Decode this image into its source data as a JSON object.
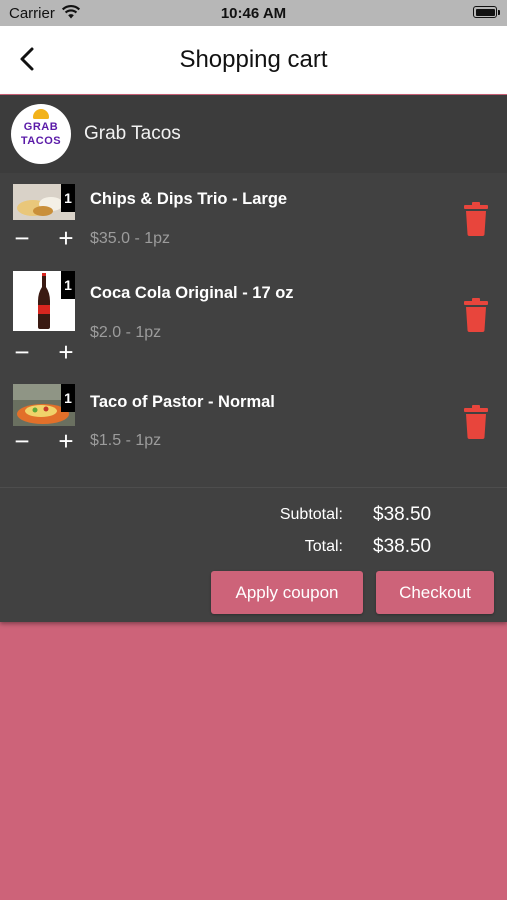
{
  "status_bar": {
    "carrier": "Carrier",
    "time": "10:46 AM"
  },
  "nav": {
    "title": "Shopping cart"
  },
  "store": {
    "name": "Grab Tacos",
    "logo_line1": "GRAB",
    "logo_line2": "TACOS"
  },
  "items": [
    {
      "name": "Chips & Dips Trio - Large",
      "price": "$35.0 - 1pz",
      "qty": "1"
    },
    {
      "name": "Coca Cola Original - 17 oz",
      "price": "$2.0 - 1pz",
      "qty": "1"
    },
    {
      "name": "Taco of Pastor - Normal",
      "price": "$1.5 - 1pz",
      "qty": "1"
    }
  ],
  "summary": {
    "subtotal_label": "Subtotal:",
    "subtotal_value": "$38.50",
    "total_label": "Total:",
    "total_value": "$38.50"
  },
  "buttons": {
    "apply_coupon": "Apply coupon",
    "checkout": "Checkout"
  },
  "colors": {
    "accent": "#cd6379",
    "panel": "#414141",
    "trash": "#e8453c"
  }
}
